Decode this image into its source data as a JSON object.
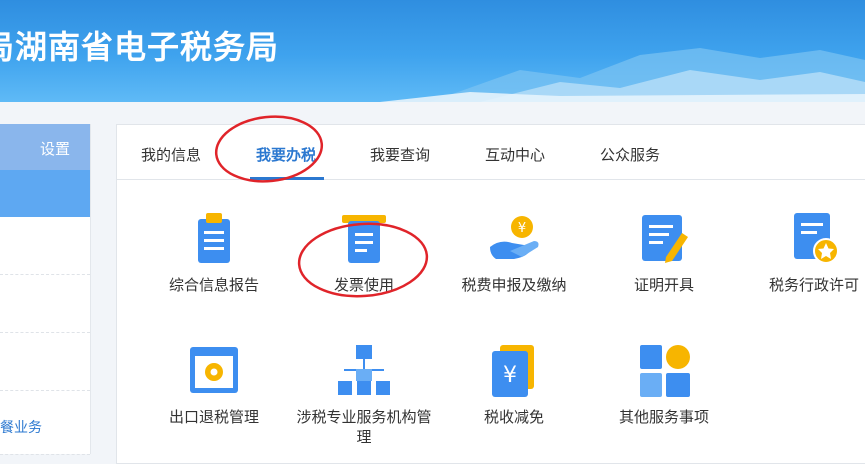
{
  "banner": {
    "title": "局湖南省电子税务局"
  },
  "sidebar": {
    "header_label": "设置",
    "link_label": "套餐业务"
  },
  "tabs": [
    {
      "label": "我的信息"
    },
    {
      "label": "我要办税"
    },
    {
      "label": "我要查询"
    },
    {
      "label": "互动中心"
    },
    {
      "label": "公众服务"
    }
  ],
  "services": [
    {
      "label": "综合信息报告",
      "icon": "clipboard-icon"
    },
    {
      "label": "发票使用",
      "icon": "invoice-icon"
    },
    {
      "label": "税费申报及缴纳",
      "icon": "hand-coin-icon"
    },
    {
      "label": "证明开具",
      "icon": "certificate-pen-icon"
    },
    {
      "label": "税务行政许可",
      "icon": "permit-star-icon"
    },
    {
      "label": "出口退税管理",
      "icon": "export-gear-icon"
    },
    {
      "label": "涉税专业服务机构管\n理",
      "icon": "org-chart-icon"
    },
    {
      "label": "税收减免",
      "icon": "yen-card-icon"
    },
    {
      "label": "其他服务事项",
      "icon": "grid-shapes-icon"
    }
  ],
  "colors": {
    "accent": "#2b78d0",
    "annotation": "#e0242a",
    "icon_blue": "#3d8ef0",
    "icon_yellow": "#f7b500"
  }
}
